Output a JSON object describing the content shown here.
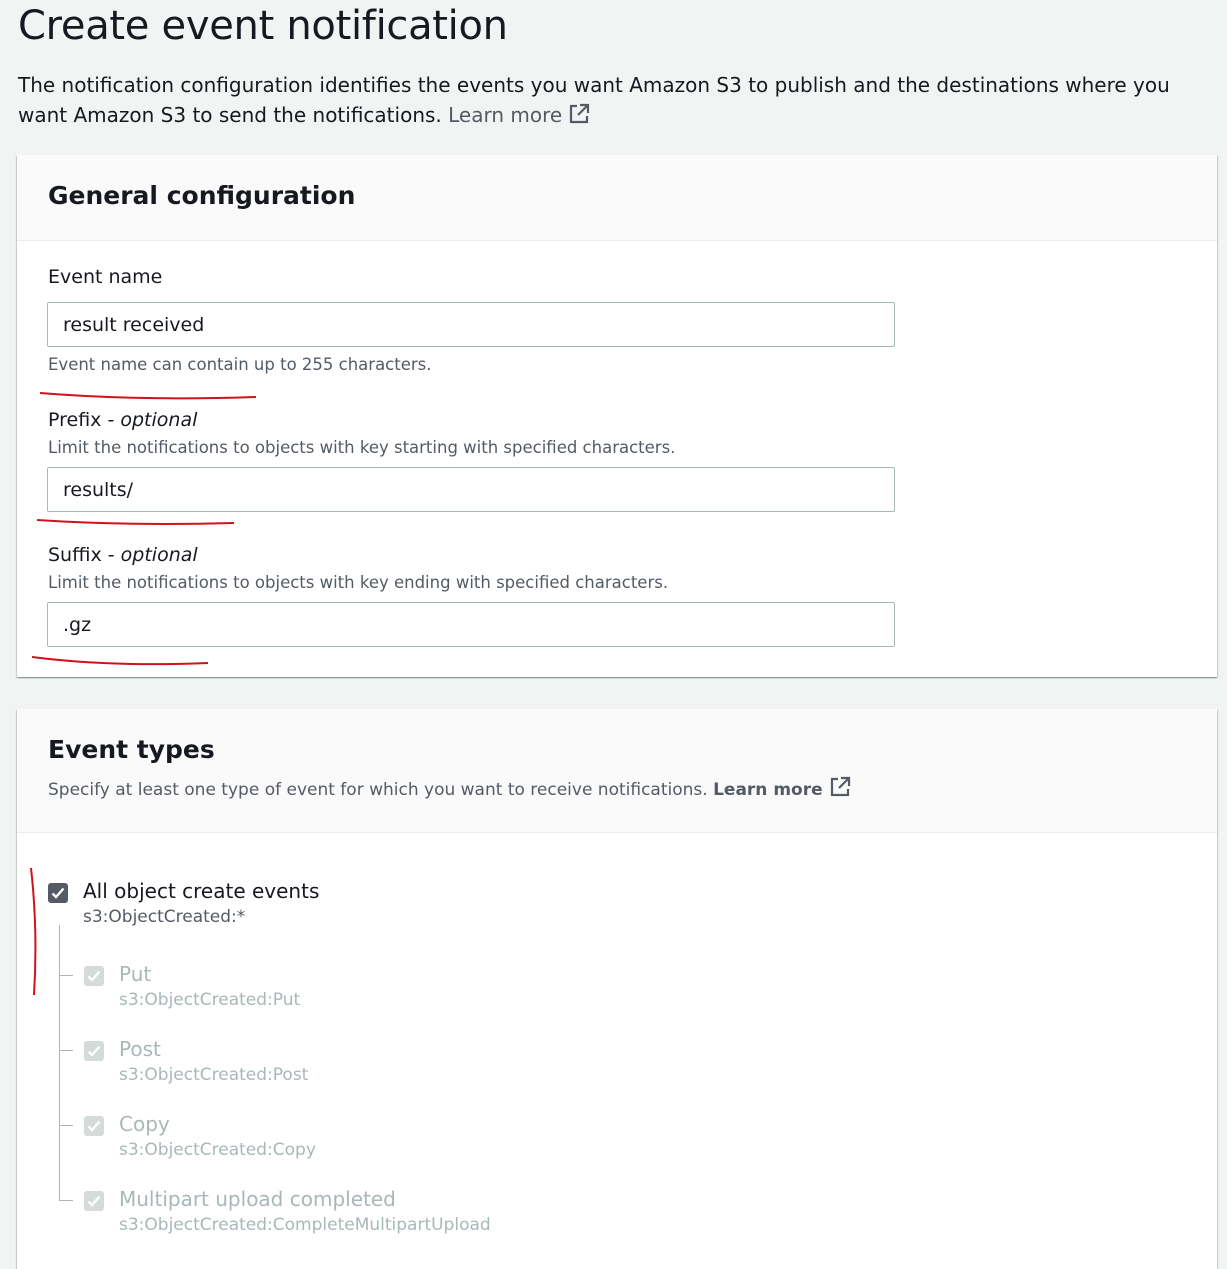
{
  "page": {
    "title": "Create event notification",
    "intro": "The notification configuration identifies the events you want Amazon S3 to publish and the destinations where you want Amazon S3 to send the notifications.",
    "learn_more": "Learn more"
  },
  "general": {
    "title": "General configuration",
    "event_name": {
      "label": "Event name",
      "value": "result received",
      "hint": "Event name can contain up to 255 characters."
    },
    "prefix": {
      "label": "Prefix -",
      "optional": "optional",
      "description": "Limit the notifications to objects with key starting with specified characters.",
      "value": "results/"
    },
    "suffix": {
      "label": "Suffix -",
      "optional": "optional",
      "description": "Limit the notifications to objects with key ending with specified characters.",
      "value": ".gz"
    }
  },
  "event_types": {
    "title": "Event types",
    "description": "Specify at least one type of event for which you want to receive notifications.",
    "learn_more": "Learn more",
    "all_create": {
      "label": "All object create events",
      "sub": "s3:ObjectCreated:*",
      "checked": true
    },
    "children": [
      {
        "label": "Put",
        "sub": "s3:ObjectCreated:Put",
        "checked": true,
        "disabled": true
      },
      {
        "label": "Post",
        "sub": "s3:ObjectCreated:Post",
        "checked": true,
        "disabled": true
      },
      {
        "label": "Copy",
        "sub": "s3:ObjectCreated:Copy",
        "checked": true,
        "disabled": true
      },
      {
        "label": "Multipart upload completed",
        "sub": "s3:ObjectCreated:CompleteMultipartUpload",
        "checked": true,
        "disabled": true
      }
    ]
  },
  "colors": {
    "page_bg": "#f2f3f3",
    "annotation": "#d0121b"
  }
}
